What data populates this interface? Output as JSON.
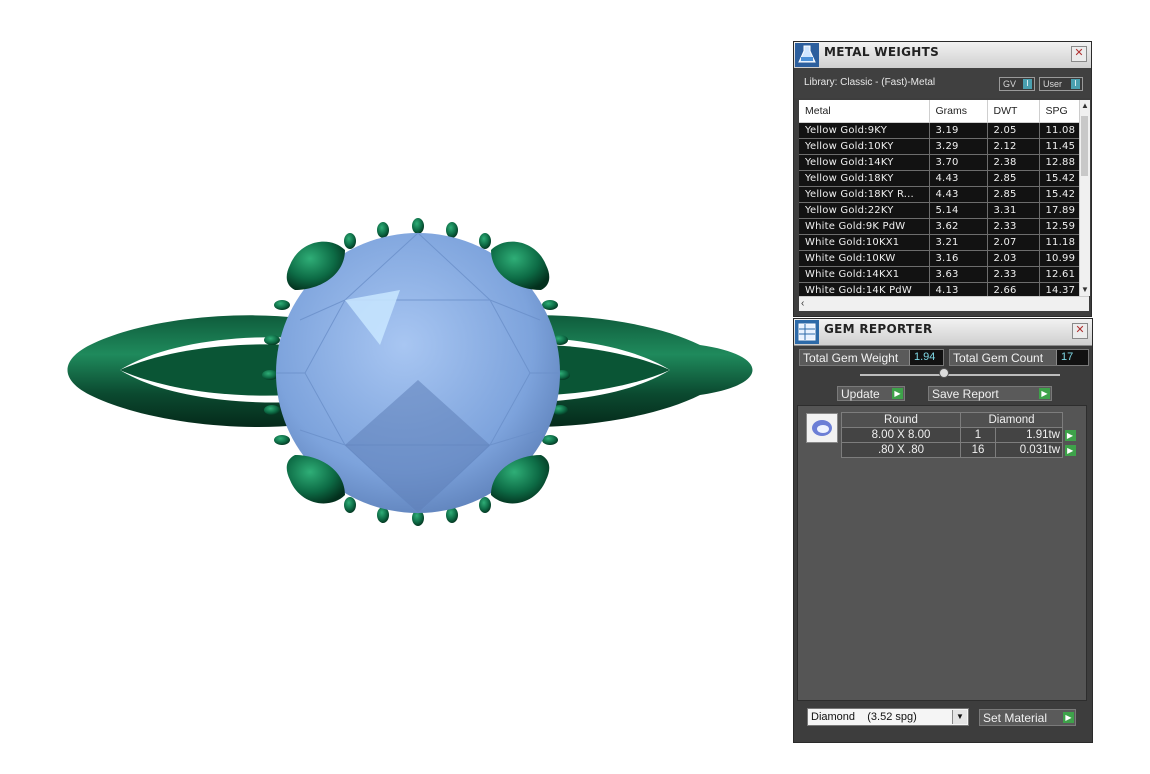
{
  "metal_weights": {
    "title": "METAL WEIGHTS",
    "library": "Library: Classic - (Fast)-Metal",
    "toggle_gv": "GV",
    "toggle_user": "User",
    "columns": [
      "Metal",
      "Grams",
      "DWT",
      "SPG"
    ],
    "rows": [
      [
        "Yellow Gold:9KY",
        "3.19",
        "2.05",
        "11.08"
      ],
      [
        "Yellow Gold:10KY",
        "3.29",
        "2.12",
        "11.45"
      ],
      [
        "Yellow Gold:14KY",
        "3.70",
        "2.38",
        "12.88"
      ],
      [
        "Yellow Gold:18KY",
        "4.43",
        "2.85",
        "15.42"
      ],
      [
        "Yellow Gold:18KY R...",
        "4.43",
        "2.85",
        "15.42"
      ],
      [
        "Yellow Gold:22KY",
        "5.14",
        "3.31",
        "17.89"
      ],
      [
        "White Gold:9K PdW",
        "3.62",
        "2.33",
        "12.59"
      ],
      [
        "White Gold:10KX1",
        "3.21",
        "2.07",
        "11.18"
      ],
      [
        "White Gold:10KW",
        "3.16",
        "2.03",
        "10.99"
      ],
      [
        "White Gold:14KX1",
        "3.63",
        "2.33",
        "12.61"
      ],
      [
        "White Gold:14K PdW",
        "4.13",
        "2.66",
        "14.37"
      ]
    ]
  },
  "gem_reporter": {
    "title": "GEM REPORTER",
    "total_weight_label": "Total Gem Weight",
    "total_weight_value": "1.94",
    "total_count_label": "Total Gem Count",
    "total_count_value": "17",
    "update_label": "Update",
    "save_report_label": "Save Report",
    "headers": [
      "Round",
      "Diamond"
    ],
    "gems": [
      {
        "size": "8.00 X 8.00",
        "count": "1",
        "weight": "1.91tw"
      },
      {
        "size": ".80 X .80",
        "count": "16",
        "weight": "0.031tw"
      }
    ],
    "material_select": "Diamond    (3.52 spg)",
    "set_material_label": "Set Material"
  },
  "colors": {
    "metal": "#0d6b45",
    "gem": "#8fb2e8",
    "panel": "#3d3d3d",
    "go_button": "#3ea24a",
    "value_text": "#7fd9e6"
  }
}
